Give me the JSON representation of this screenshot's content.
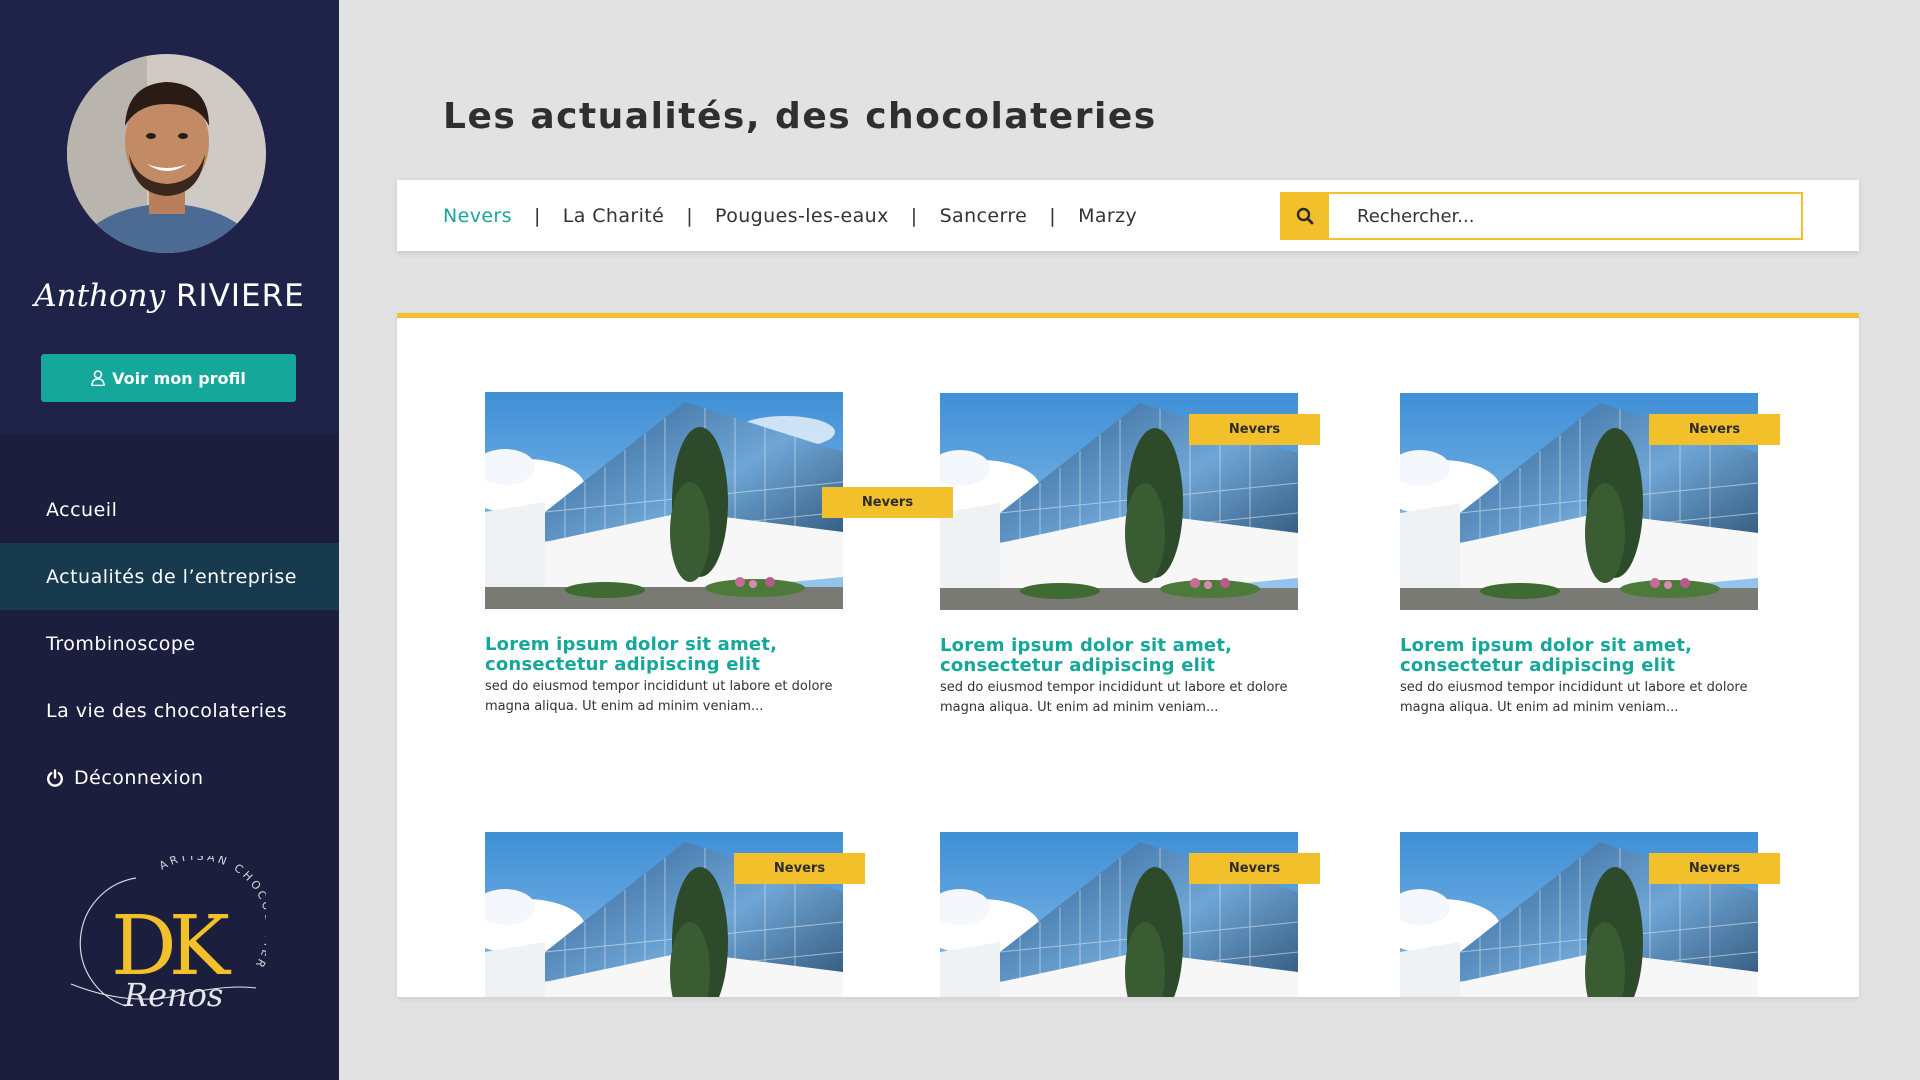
{
  "user": {
    "first_name": "Anthony",
    "last_name": "RIVIERE",
    "profile_button": "Voir mon profil"
  },
  "nav": {
    "items": [
      {
        "label": "Accueil"
      },
      {
        "label": "Actualités de l’entreprise"
      },
      {
        "label": "Trombinoscope"
      },
      {
        "label": "La vie des chocolateries"
      },
      {
        "label": "Déconnexion"
      }
    ]
  },
  "logo": {
    "monogram": "DK",
    "arc_text": "ARTISAN CHOCOLATIER",
    "signature": "Renos"
  },
  "page": {
    "title_bold": "Les actualités,",
    "title_rest": "des chocolateries"
  },
  "cities": {
    "tabs": [
      "Nevers",
      "La Charité",
      "Pougues-les-eaux",
      "Sancerre",
      "Marzy"
    ],
    "separator": "|"
  },
  "search": {
    "placeholder": "Rechercher..."
  },
  "colors": {
    "sidebar": "#1b1e3d",
    "accent_teal": "#16a79b",
    "accent_yellow": "#f2c02a"
  },
  "articles": [
    {
      "city": "Nevers",
      "title": "Lorem ipsum dolor sit amet, consectetur adipiscing elit",
      "excerpt": "sed do eiusmod tempor incididunt ut labore et dolore magna aliqua. Ut enim ad minim veniam..."
    },
    {
      "city": "Nevers",
      "title": "Lorem ipsum dolor sit amet, consectetur adipiscing elit",
      "excerpt": "sed do eiusmod tempor incididunt ut labore et dolore magna aliqua. Ut enim ad minim veniam..."
    },
    {
      "city": "Nevers",
      "title": "Lorem ipsum dolor sit amet, consectetur adipiscing elit",
      "excerpt": "sed do eiusmod tempor incididunt ut labore et dolore magna aliqua. Ut enim ad minim veniam..."
    },
    {
      "city": "Nevers",
      "title": "",
      "excerpt": ""
    },
    {
      "city": "Nevers",
      "title": "",
      "excerpt": ""
    },
    {
      "city": "Nevers",
      "title": "",
      "excerpt": ""
    }
  ]
}
